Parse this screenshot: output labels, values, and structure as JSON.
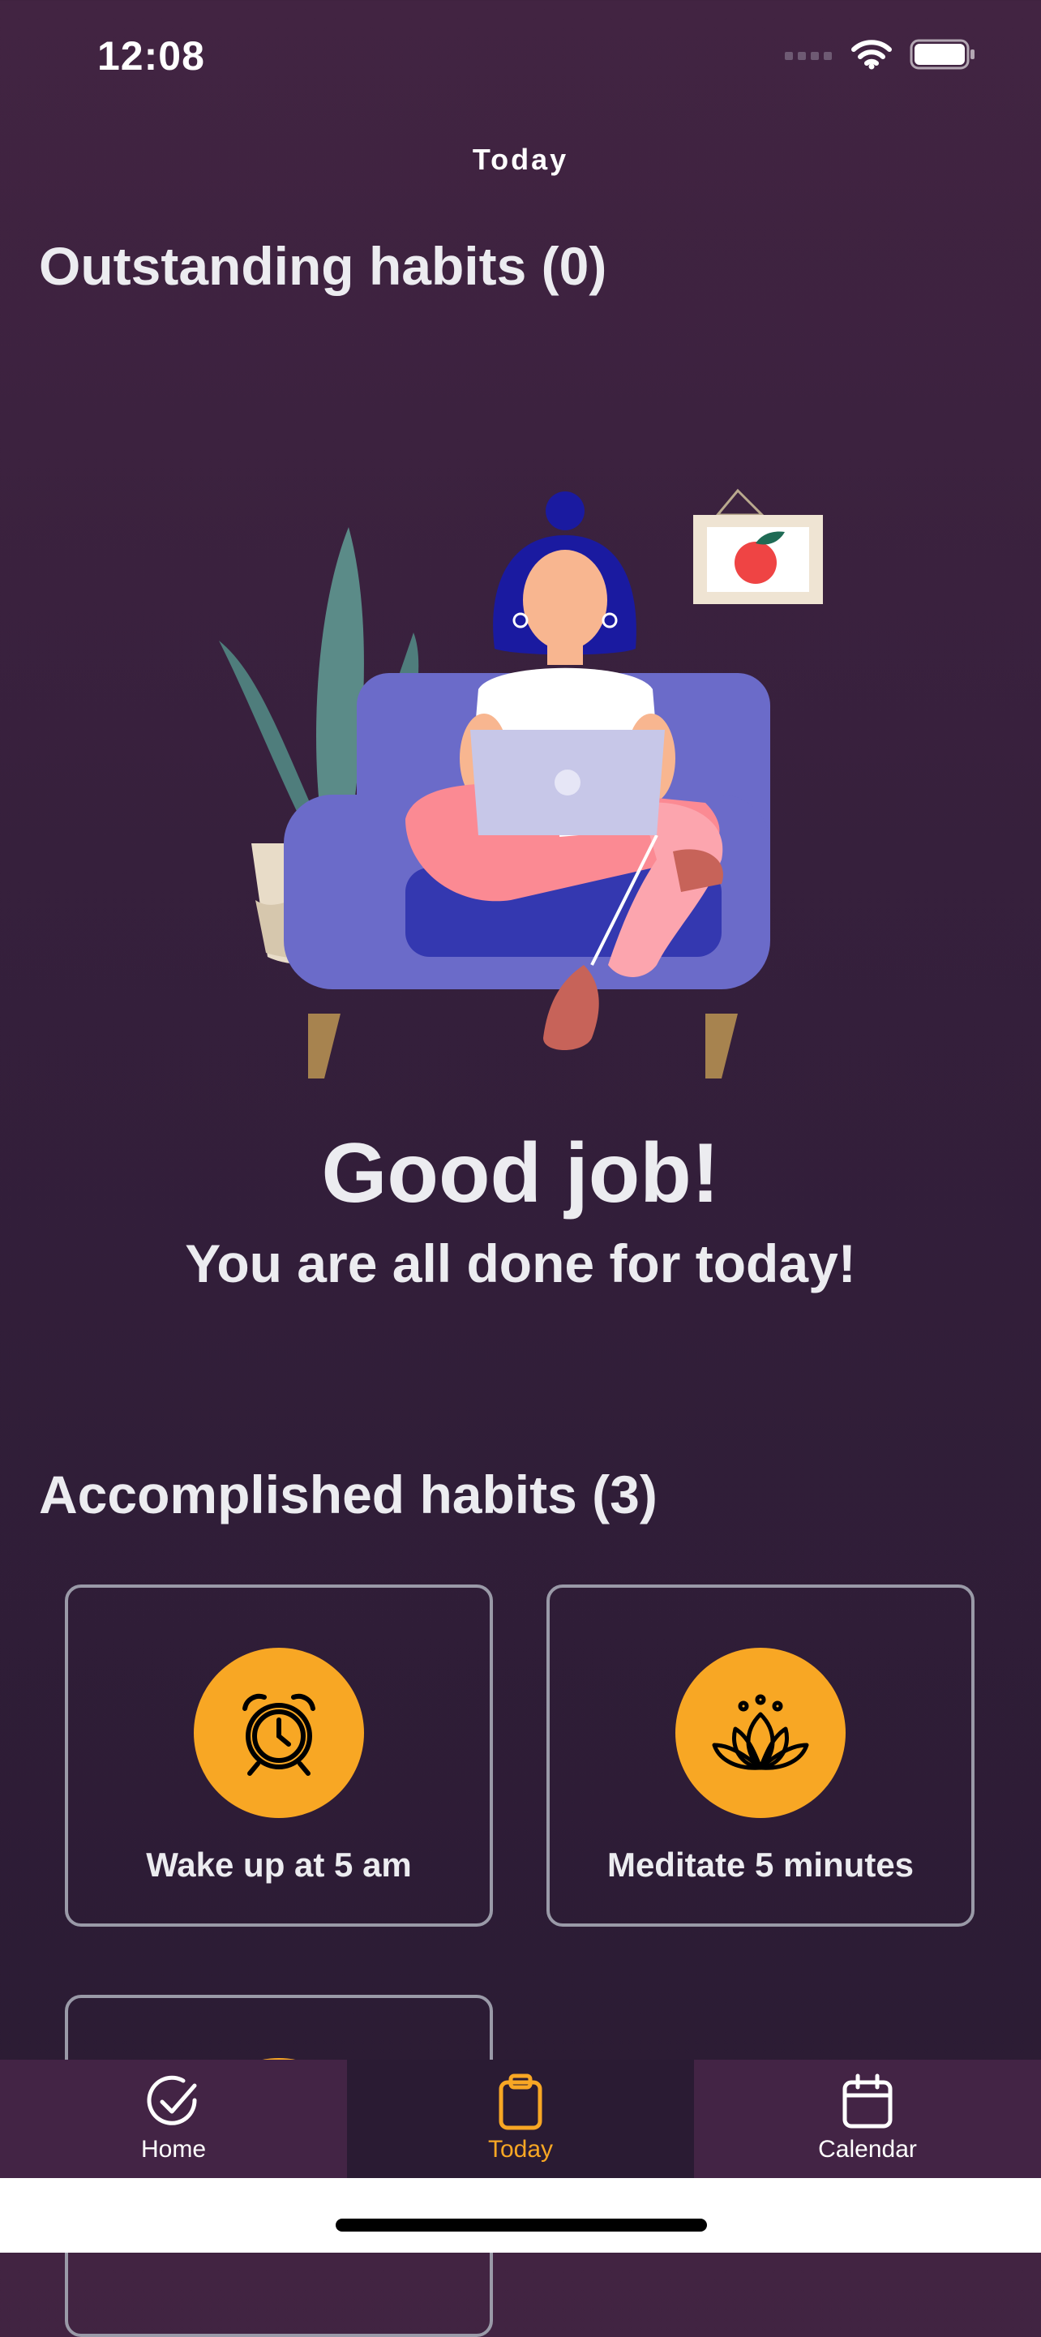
{
  "status_bar": {
    "time": "12:08"
  },
  "nav": {
    "title": "Today"
  },
  "outstanding": {
    "title": "Outstanding habits (0)"
  },
  "empty_state": {
    "headline": "Good job!",
    "subline": "You are all done for today!"
  },
  "accomplished": {
    "title": "Accomplished habits (3)",
    "habits": [
      {
        "label": "Wake up at 5 am",
        "icon": "alarm-clock-icon"
      },
      {
        "label": "Meditate 5 minutes",
        "icon": "lotus-icon"
      },
      {
        "label": "",
        "icon": ""
      }
    ]
  },
  "tabs": [
    {
      "label": "Home",
      "icon": "check-circle-icon",
      "active": false
    },
    {
      "label": "Today",
      "icon": "clipboard-icon",
      "active": true
    },
    {
      "label": "Calendar",
      "icon": "calendar-icon",
      "active": false
    }
  ],
  "colors": {
    "background_top": "#422442",
    "background_bottom": "#2a1b33",
    "accent": "#f8a724",
    "card_border": "#9a9aa8",
    "tab_bar": "#432445"
  }
}
